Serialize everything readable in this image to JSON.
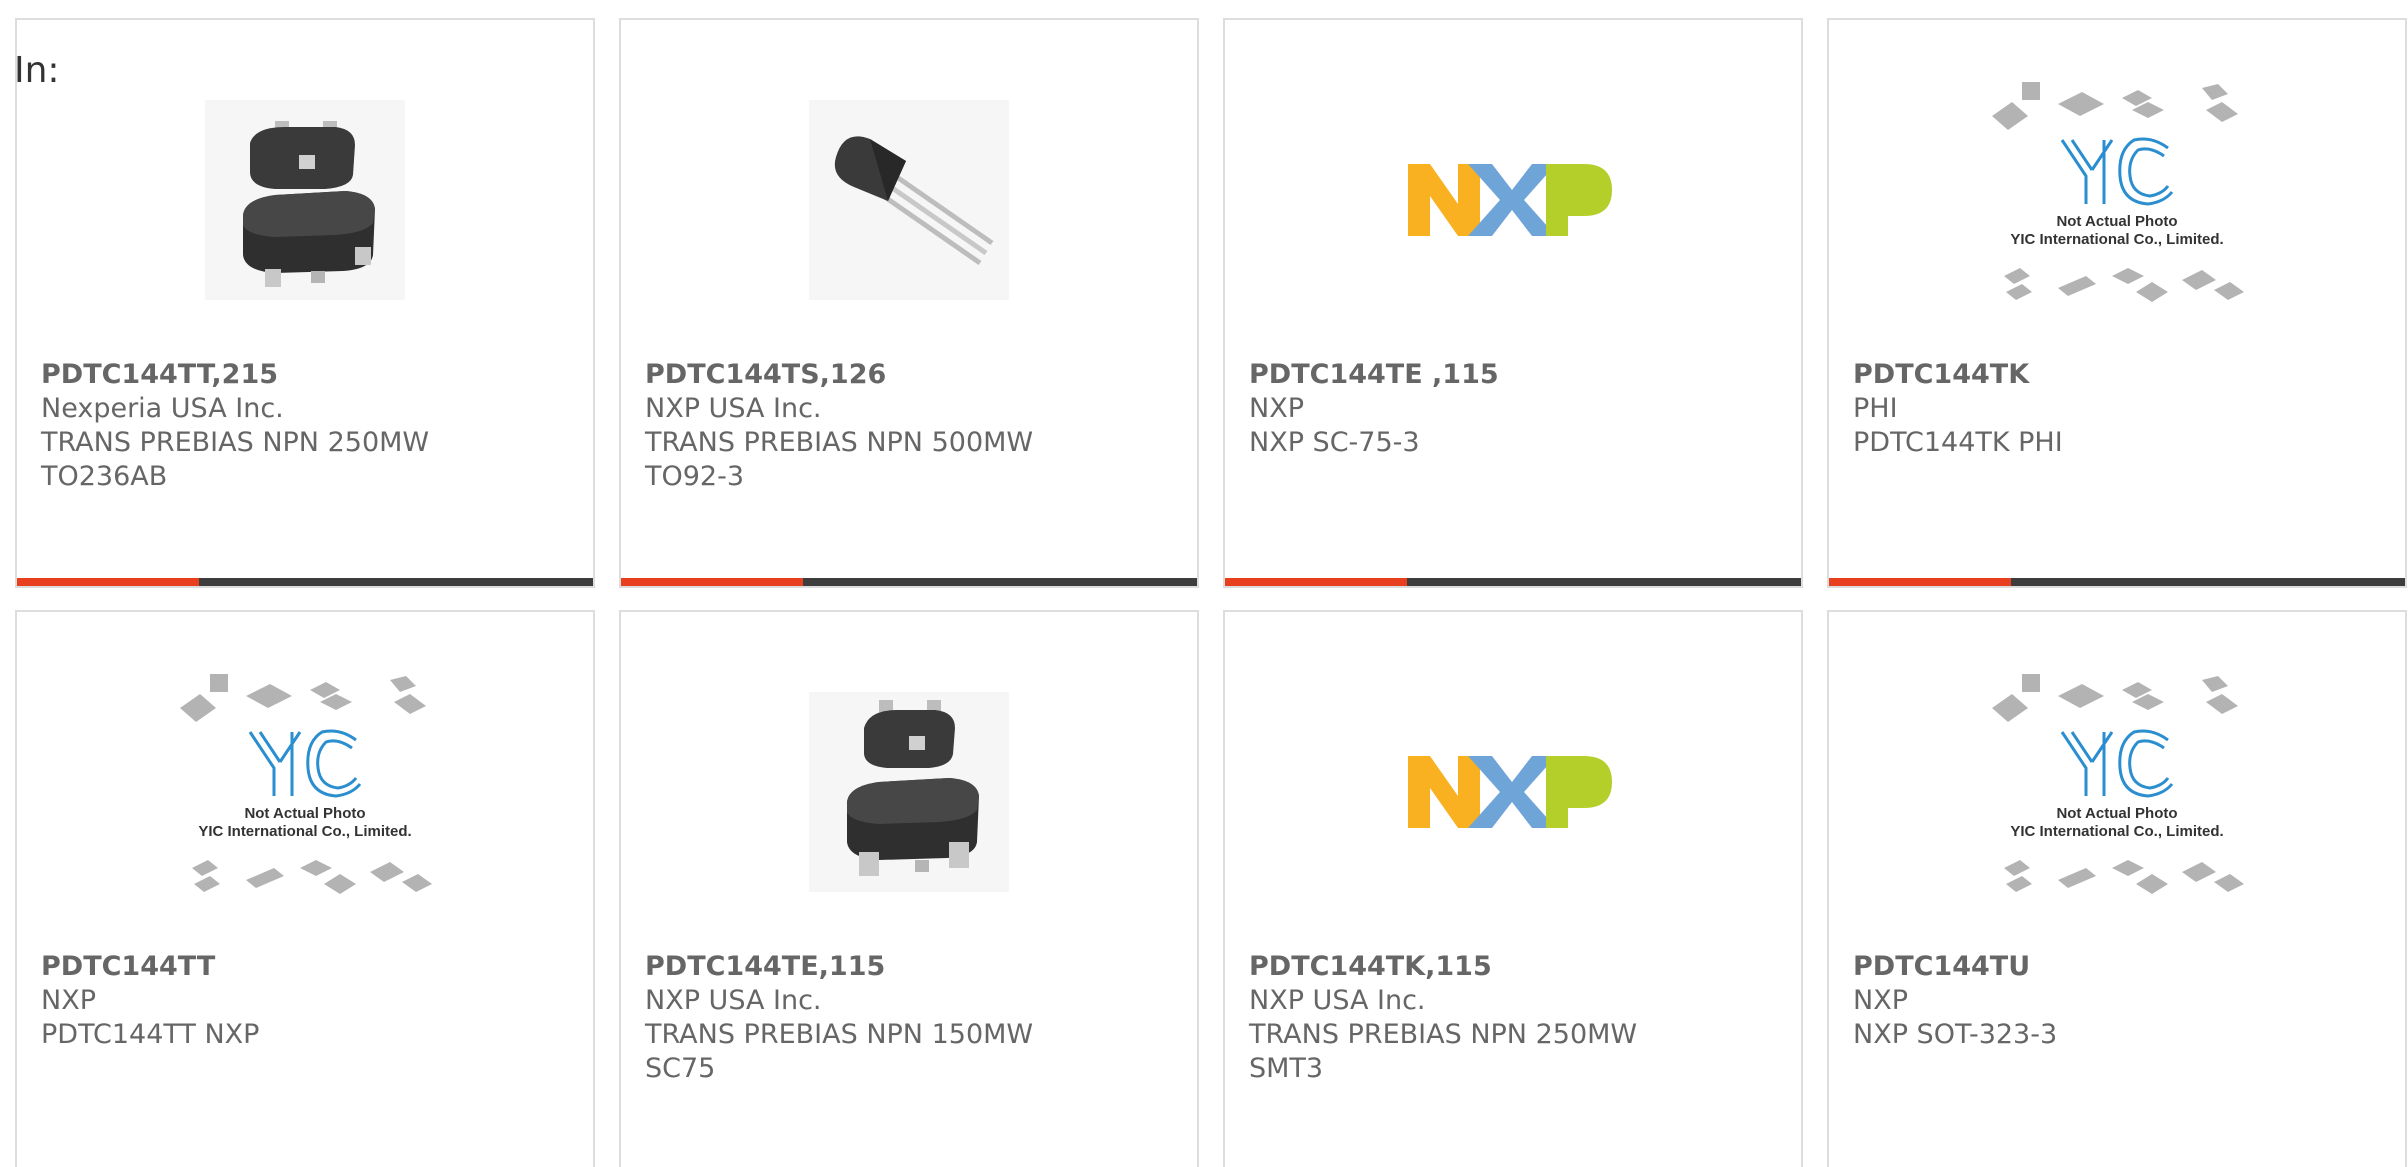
{
  "header": {
    "in_label": "In:"
  },
  "products": [
    {
      "part_number": "PDTC144TT,215",
      "manufacturer": "Nexperia USA Inc.",
      "desc_1": "TRANS PREBIAS NPN 250MW",
      "desc_2": "TO236AB",
      "image": "sot23-package-photo"
    },
    {
      "part_number": "PDTC144TS,126",
      "manufacturer": "NXP USA Inc.",
      "desc_1": "TRANS PREBIAS NPN 500MW",
      "desc_2": "TO92-3",
      "image": "to92-package-photo"
    },
    {
      "part_number": "PDTC144TE ,115",
      "manufacturer": "NXP",
      "desc_1": "NXP SC-75-3",
      "desc_2": "",
      "image": "nxp-logo"
    },
    {
      "part_number": "PDTC144TK",
      "manufacturer": "PHI",
      "desc_1": "PDTC144TK PHI",
      "desc_2": "",
      "image": "yic-placeholder",
      "image_text": [
        "Not Actual Photo",
        "YIC International Co., Limited."
      ]
    },
    {
      "part_number": "PDTC144TT",
      "manufacturer": "NXP",
      "desc_1": "PDTC144TT NXP",
      "desc_2": "",
      "image": "yic-placeholder",
      "image_text": [
        "Not Actual Photo",
        "YIC International Co., Limited."
      ]
    },
    {
      "part_number": "PDTC144TE,115",
      "manufacturer": "NXP USA Inc.",
      "desc_1": "TRANS PREBIAS NPN 150MW",
      "desc_2": "SC75",
      "image": "sot23-package-photo"
    },
    {
      "part_number": "PDTC144TK,115",
      "manufacturer": "NXP USA Inc.",
      "desc_1": "TRANS PREBIAS NPN 250MW",
      "desc_2": "SMT3",
      "image": "nxp-logo"
    },
    {
      "part_number": "PDTC144TU",
      "manufacturer": "NXP",
      "desc_1": "NXP SOT-323-3",
      "desc_2": "",
      "image": "yic-placeholder",
      "image_text": [
        "Not Actual Photo",
        "YIC International Co., Limited."
      ]
    }
  ],
  "colors": {
    "accent": "#e8401e",
    "bar": "#3d3d3d",
    "text": "#666666",
    "nxp_orange": "#f9b122",
    "nxp_blue": "#6ea4d8",
    "nxp_green": "#b5cf2a"
  }
}
